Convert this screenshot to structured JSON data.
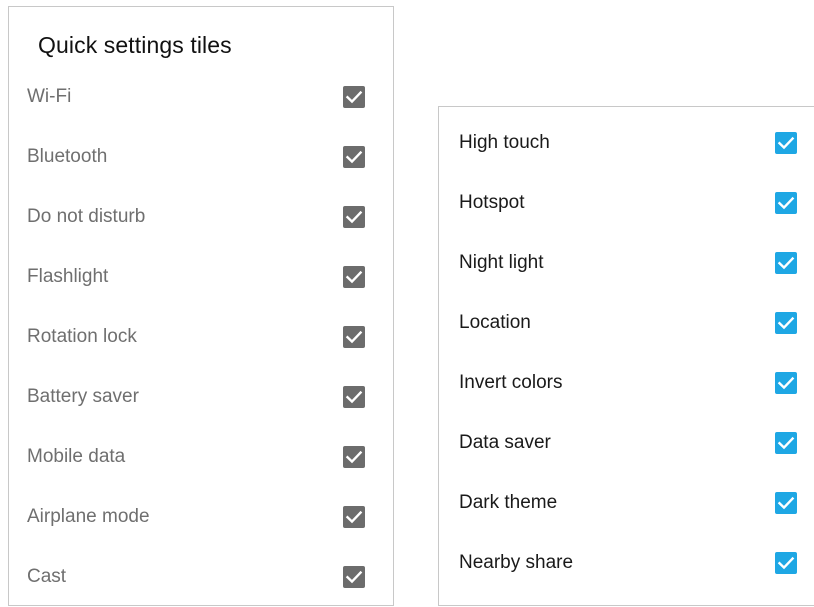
{
  "left_panel": {
    "title": "Quick settings tiles",
    "check_color": "#6c6c6c",
    "items": [
      {
        "label": "Wi-Fi",
        "checked": true
      },
      {
        "label": "Bluetooth",
        "checked": true
      },
      {
        "label": "Do not disturb",
        "checked": true
      },
      {
        "label": "Flashlight",
        "checked": true
      },
      {
        "label": "Rotation lock",
        "checked": true
      },
      {
        "label": "Battery saver",
        "checked": true
      },
      {
        "label": "Mobile data",
        "checked": true
      },
      {
        "label": "Airplane mode",
        "checked": true
      },
      {
        "label": "Cast",
        "checked": true
      }
    ]
  },
  "right_panel": {
    "check_color": "#1ea7e4",
    "items": [
      {
        "label": "High touch",
        "checked": true
      },
      {
        "label": "Hotspot",
        "checked": true
      },
      {
        "label": "Night light",
        "checked": true
      },
      {
        "label": "Location",
        "checked": true
      },
      {
        "label": "Invert colors",
        "checked": true
      },
      {
        "label": "Data saver",
        "checked": true
      },
      {
        "label": "Dark theme",
        "checked": true
      },
      {
        "label": "Nearby share",
        "checked": true
      }
    ]
  }
}
